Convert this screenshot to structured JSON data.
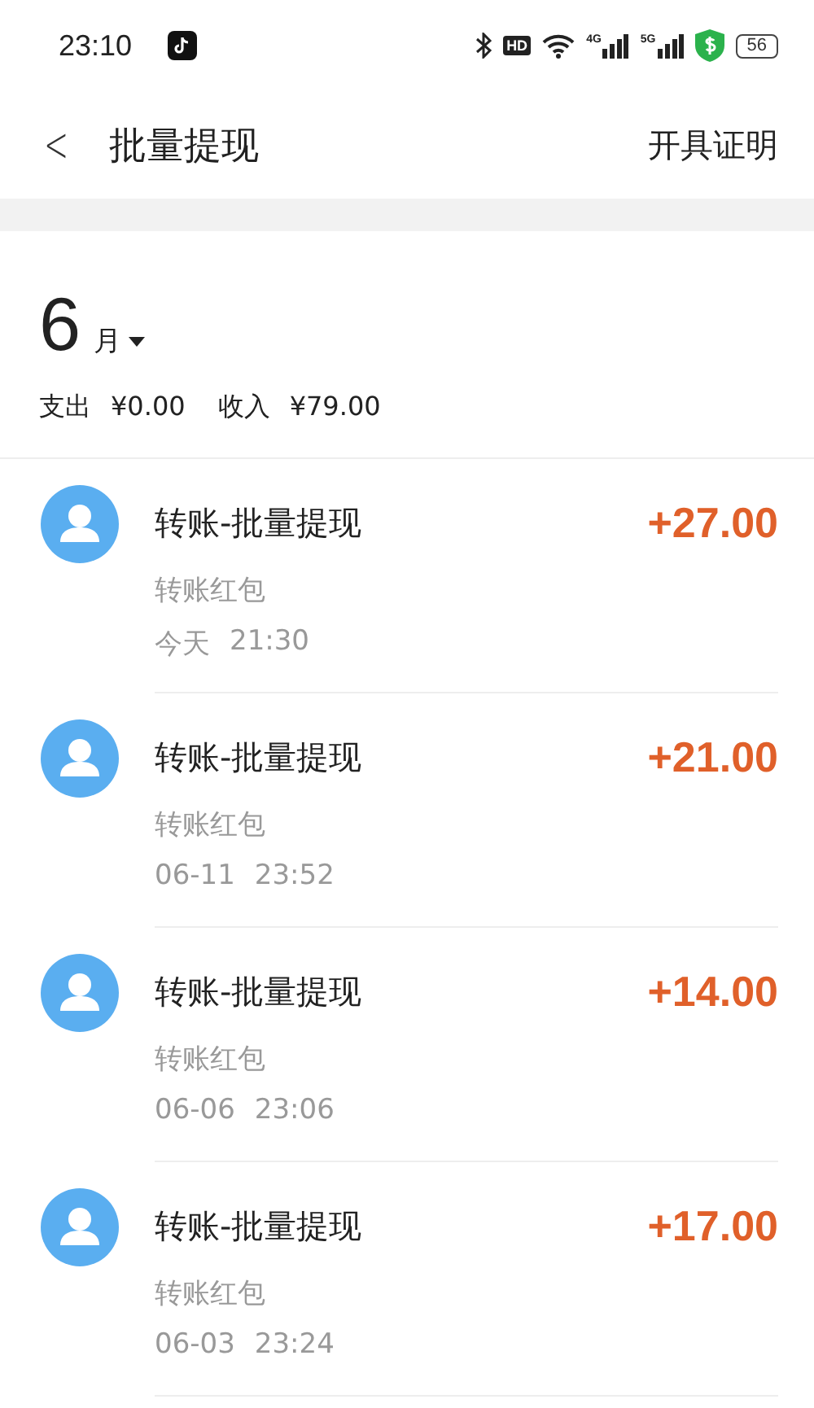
{
  "status_bar": {
    "time": "23:10",
    "hd": "HD",
    "network_1": "4G",
    "network_2": "5G",
    "battery": "56"
  },
  "header": {
    "back": "<",
    "title": "批量提现",
    "action": "开具证明"
  },
  "month": {
    "number": "6",
    "unit": "月"
  },
  "summary": {
    "expense_label": "支出",
    "expense": "¥0.00",
    "income_label": "收入",
    "income": "¥79.00"
  },
  "transactions": [
    {
      "title": "转账-批量提现",
      "subtitle": "转账红包",
      "date": "今天",
      "time": "21:30",
      "amount": "+27.00"
    },
    {
      "title": "转账-批量提现",
      "subtitle": "转账红包",
      "date": "06-11",
      "time": "23:52",
      "amount": "+21.00"
    },
    {
      "title": "转账-批量提现",
      "subtitle": "转账红包",
      "date": "06-06",
      "time": "23:06",
      "amount": "+14.00"
    },
    {
      "title": "转账-批量提现",
      "subtitle": "转账红包",
      "date": "06-03",
      "time": "23:24",
      "amount": "+17.00"
    }
  ]
}
